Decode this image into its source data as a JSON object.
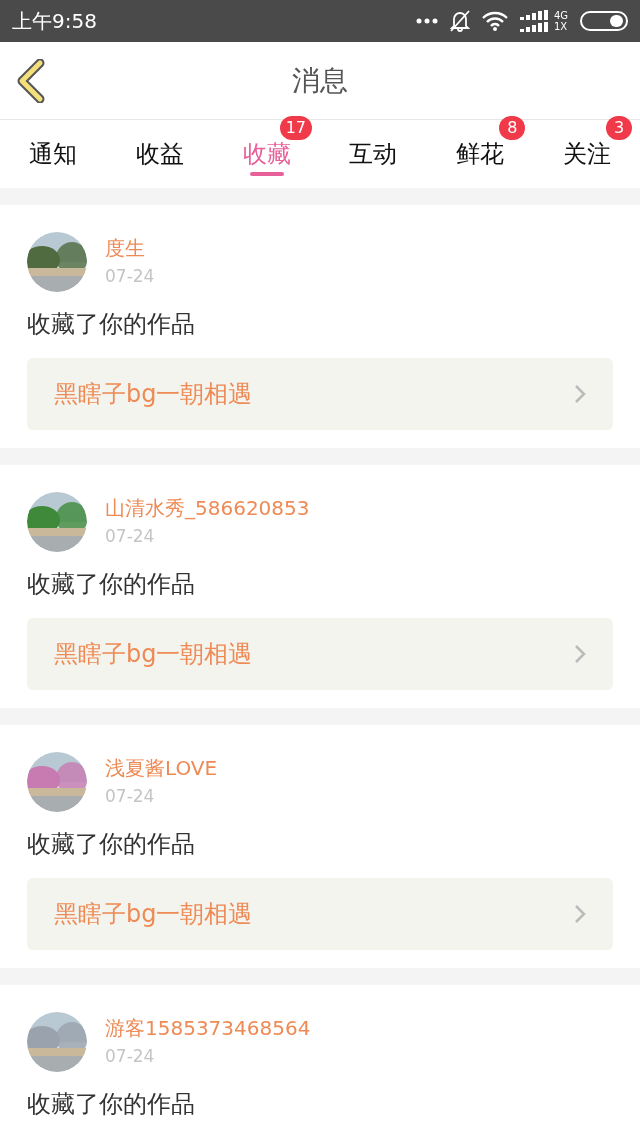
{
  "status_bar": {
    "time": "上午9:58",
    "network_top": "4G",
    "network_bottom": "1X"
  },
  "header": {
    "title": "消息"
  },
  "tabs": [
    {
      "label": "通知",
      "selected": false
    },
    {
      "label": "收益",
      "selected": false
    },
    {
      "label": "收藏",
      "selected": true,
      "badge": "17"
    },
    {
      "label": "互动",
      "selected": false
    },
    {
      "label": "鲜花",
      "selected": false,
      "badge": "8"
    },
    {
      "label": "关注",
      "selected": false,
      "badge": "3"
    }
  ],
  "messages": [
    {
      "user": "度生",
      "date": "07-24",
      "text": "收藏了你的作品",
      "work": "黑瞎子bg一朝相遇"
    },
    {
      "user": "山清水秀_586620853",
      "date": "07-24",
      "text": "收藏了你的作品",
      "work": "黑瞎子bg一朝相遇"
    },
    {
      "user": "浅夏酱LOVE",
      "date": "07-24",
      "text": "收藏了你的作品",
      "work": "黑瞎子bg一朝相遇"
    },
    {
      "user": "游客1585373468564",
      "date": "07-24",
      "text": "收藏了你的作品"
    }
  ]
}
